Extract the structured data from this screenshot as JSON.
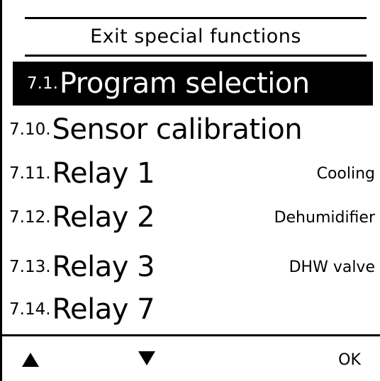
{
  "header": {
    "title": "Exit special functions"
  },
  "menu": [
    {
      "number": "7.1.",
      "label": "Program selection",
      "value": ""
    },
    {
      "number": "7.10.",
      "label": "Sensor calibration",
      "value": ""
    },
    {
      "number": "7.11.",
      "label": "Relay 1",
      "value": "Cooling"
    },
    {
      "number": "7.12.",
      "label": "Relay 2",
      "value": "Dehumidifier"
    },
    {
      "number": "7.13.",
      "label": "Relay 3",
      "value": "DHW valve"
    },
    {
      "number": "7.14.",
      "label": "Relay 7",
      "value": ""
    }
  ],
  "selected_index": 0,
  "footer": {
    "up_icon": "triangle-up-icon",
    "down_icon": "triangle-down-icon",
    "ok_label": "OK"
  }
}
